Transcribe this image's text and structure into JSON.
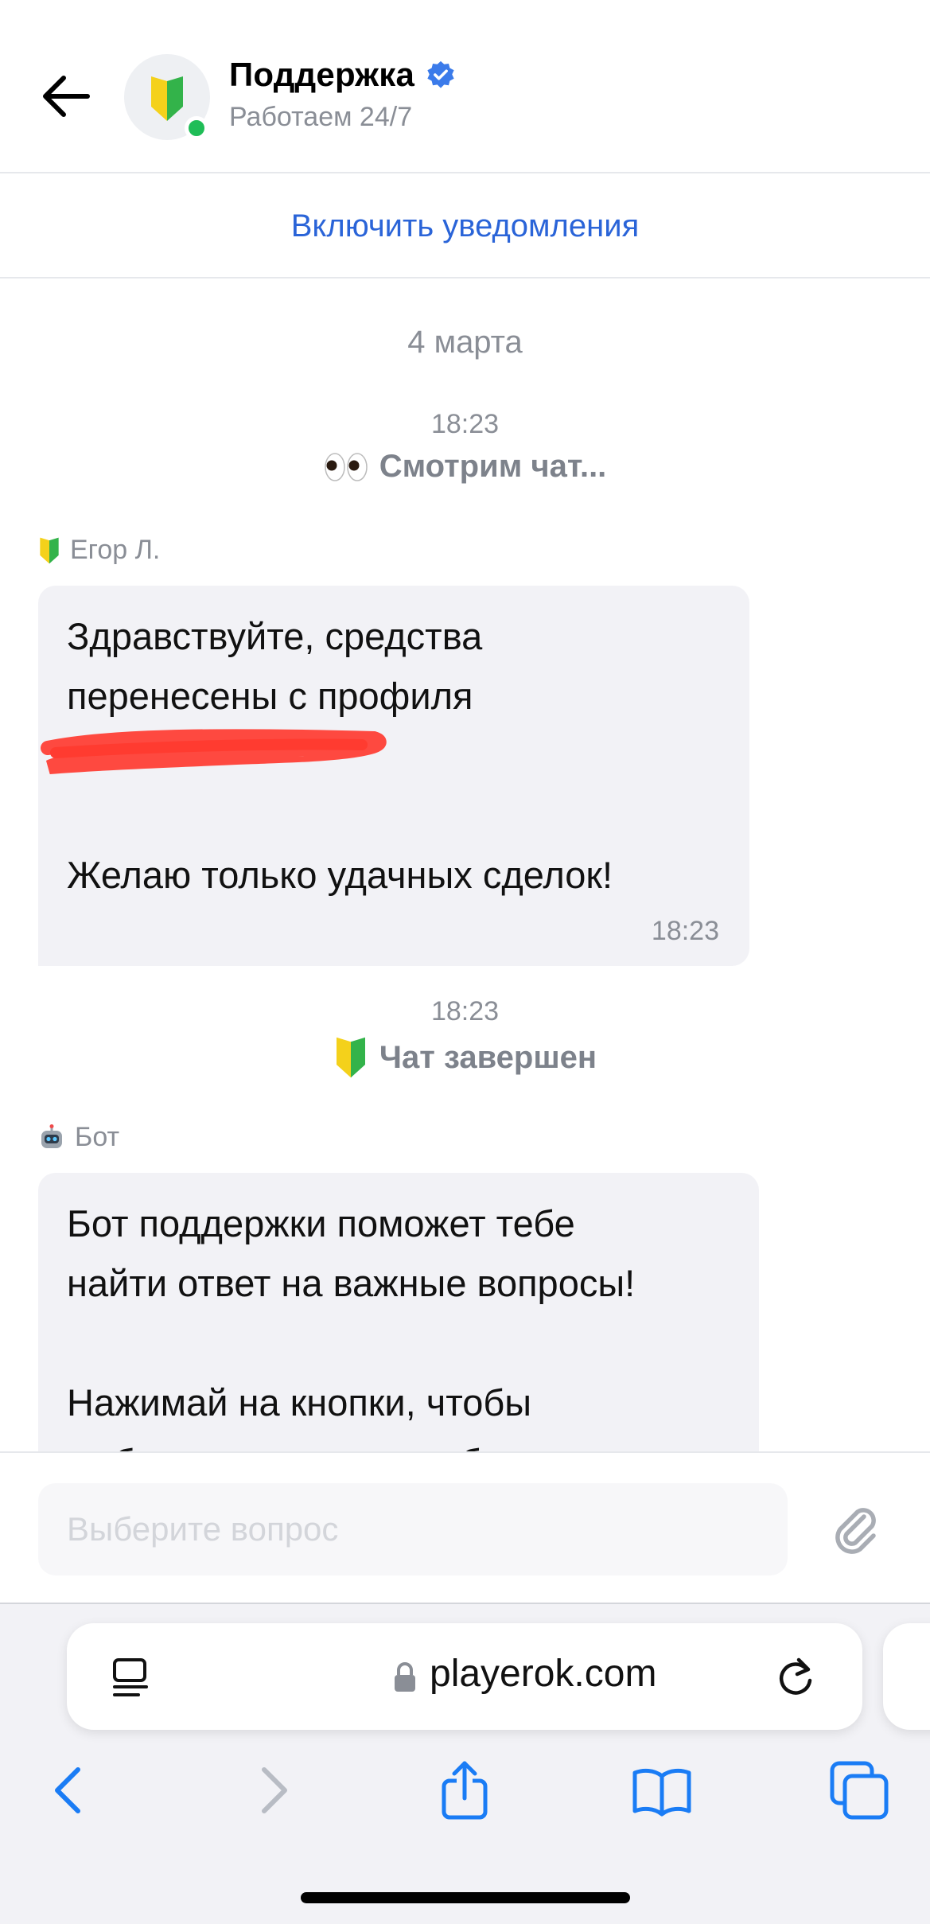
{
  "header": {
    "title": "Поддержка",
    "subtitle": "Работаем 24/7",
    "online_color": "#1fbd57",
    "verified_color": "#3b7bea"
  },
  "notify": {
    "label": "Включить уведомления"
  },
  "chat": {
    "date": "4 марта",
    "events": [
      {
        "time": "18:23",
        "text": "Смотрим чат...",
        "icon": "eyes-icon"
      },
      {
        "time": "18:23",
        "text": "Чат завершен",
        "icon": "beginner-badge-icon"
      }
    ],
    "messages": [
      {
        "sender": "Егор Л.",
        "sender_icon": "beginner-badge-icon",
        "lines": [
          "Здравствуйте, средства",
          "перенесены с профиля"
        ],
        "closing": "Желаю только удачных сделок!",
        "time": "18:23"
      },
      {
        "sender": "Бот",
        "sender_icon": "robot-icon",
        "lines": [
          "Бот поддержки поможет тебе",
          "найти ответ на важные вопросы!"
        ],
        "closing": "Нажимай на кнопки, чтобы",
        "truncated": "выбрать тему своего обращения и"
      }
    ]
  },
  "input": {
    "placeholder": "Выберите вопрос"
  },
  "browser": {
    "url": "playerok.com"
  },
  "colors": {
    "accent": "#2a64d8",
    "bubble": "#f2f2f6",
    "ios_blue": "#1a7cf5"
  }
}
